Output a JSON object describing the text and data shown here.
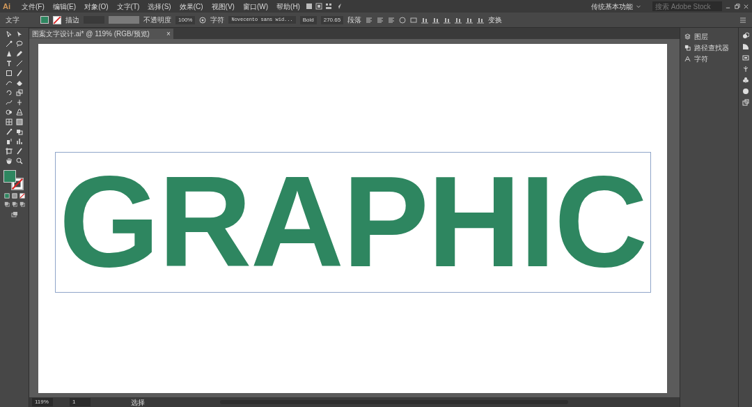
{
  "app": {
    "logo": "Ai",
    "menus": [
      "文件(F)",
      "编辑(E)",
      "对象(O)",
      "文字(T)",
      "选择(S)",
      "效果(C)",
      "视图(V)",
      "窗口(W)",
      "帮助(H)"
    ],
    "workspace": "传统基本功能",
    "search": {
      "placeholder": "搜索 Adobe Stock"
    }
  },
  "control_bar": {
    "mode": "文字",
    "stroke_label": "描边",
    "opacity_label": "不透明度",
    "opacity": "100%",
    "character_label": "字符",
    "font": "Novecento sans wid...",
    "font_style": "Bold",
    "font_size": "270.65",
    "paragraph_label": "段落",
    "transform": "变换"
  },
  "document_tab": {
    "title": "图案文字设计.ai* @ 119% (RGB/预览)",
    "close": "×"
  },
  "canvas": {
    "text": "GRAPHIC"
  },
  "panels": [
    {
      "label": "图层"
    },
    {
      "label": "路径查找器"
    },
    {
      "label": "字符"
    }
  ],
  "status_bar": {
    "zoom": "119%",
    "artboard": "1",
    "tool": "选择"
  }
}
